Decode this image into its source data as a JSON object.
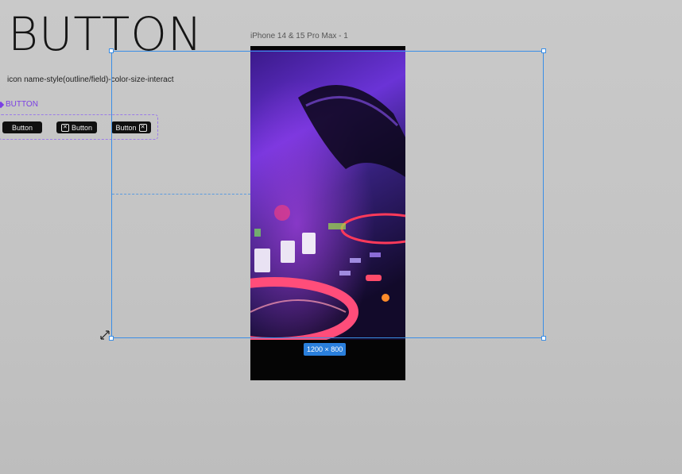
{
  "canvas": {
    "heading": "BUTTON",
    "naming_note": "icon name-style(outline/field)-color-size-interact",
    "component_set": {
      "label": "BUTTON",
      "accent_color": "#7b3fe4",
      "variants": [
        {
          "label": "Button",
          "icon": ""
        },
        {
          "label": "Button",
          "icon": "close-box-icon-left"
        },
        {
          "label": "Button",
          "icon": "close-box-icon-right"
        }
      ]
    }
  },
  "frame": {
    "name": "iPhone 14 & 15 Pro Max - 1"
  },
  "selection": {
    "size_label": "1200 × 800",
    "color": "#3a8ee6"
  },
  "icons": {
    "component_marker": "diamond-icon",
    "close_box": "x-box-icon",
    "cursor": "resize-diagonal-cursor-icon"
  }
}
